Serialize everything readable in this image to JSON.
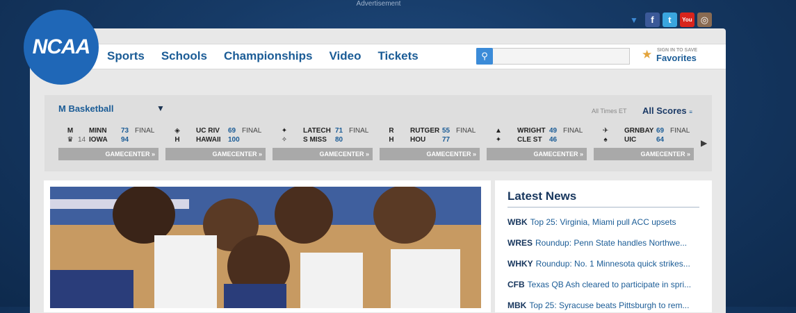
{
  "ad_label": "Advertisement",
  "logo_text": "NCAA",
  "nav": [
    "Sports",
    "Schools",
    "Championships",
    "Video",
    "Tickets"
  ],
  "search": {
    "placeholder": ""
  },
  "favorites": {
    "small": "SIGN IN TO SAVE",
    "big": "Favorites"
  },
  "social": [
    "facebook",
    "twitter",
    "youtube",
    "instagram"
  ],
  "scoreboard": {
    "sport": "M Basketball",
    "times": "All Times ET",
    "all_scores": "All Scores",
    "gamecenter_label": "GAMECENTER »",
    "games": [
      {
        "teams": [
          {
            "rank": "",
            "name": "MINN",
            "score": "73",
            "status": "FINAL",
            "logo": "M"
          },
          {
            "rank": "14",
            "name": "IOWA",
            "score": "94",
            "status": "",
            "logo": "♛"
          }
        ]
      },
      {
        "teams": [
          {
            "rank": "",
            "name": "UC RIV",
            "score": "69",
            "status": "FINAL",
            "logo": "◈"
          },
          {
            "rank": "",
            "name": "HAWAII",
            "score": "100",
            "status": "",
            "logo": "H"
          }
        ]
      },
      {
        "teams": [
          {
            "rank": "",
            "name": "LATECH",
            "score": "71",
            "status": "FINAL",
            "logo": "✦"
          },
          {
            "rank": "",
            "name": "S MISS",
            "score": "80",
            "status": "",
            "logo": "✧"
          }
        ]
      },
      {
        "teams": [
          {
            "rank": "",
            "name": "RUTGER",
            "score": "55",
            "status": "FINAL",
            "logo": "R"
          },
          {
            "rank": "",
            "name": "HOU",
            "score": "77",
            "status": "",
            "logo": "H"
          }
        ]
      },
      {
        "teams": [
          {
            "rank": "",
            "name": "WRIGHT",
            "score": "49",
            "status": "FINAL",
            "logo": "▲"
          },
          {
            "rank": "",
            "name": "CLE ST",
            "score": "46",
            "status": "",
            "logo": "✦"
          }
        ]
      },
      {
        "teams": [
          {
            "rank": "",
            "name": "GRNBAY",
            "score": "69",
            "status": "FINAL",
            "logo": "✈"
          },
          {
            "rank": "",
            "name": "UIC",
            "score": "64",
            "status": "",
            "logo": "♠"
          }
        ]
      }
    ]
  },
  "latest_news": {
    "title": "Latest News",
    "items": [
      {
        "tag": "WBK",
        "text": "Top 25: Virginia, Miami pull ACC upsets"
      },
      {
        "tag": "WRES",
        "text": "Roundup: Penn State handles Northwe..."
      },
      {
        "tag": "WHKY",
        "text": "Roundup: No. 1 Minnesota quick strikes..."
      },
      {
        "tag": "CFB",
        "text": "Texas QB Ash cleared to participate in spri..."
      },
      {
        "tag": "MBK",
        "text": "Top 25: Syracuse beats Pittsburgh to rem..."
      }
    ]
  },
  "colors": {
    "brand_blue": "#1f67b7",
    "link_blue": "#1b5c96",
    "page_bg": "#163a66"
  }
}
